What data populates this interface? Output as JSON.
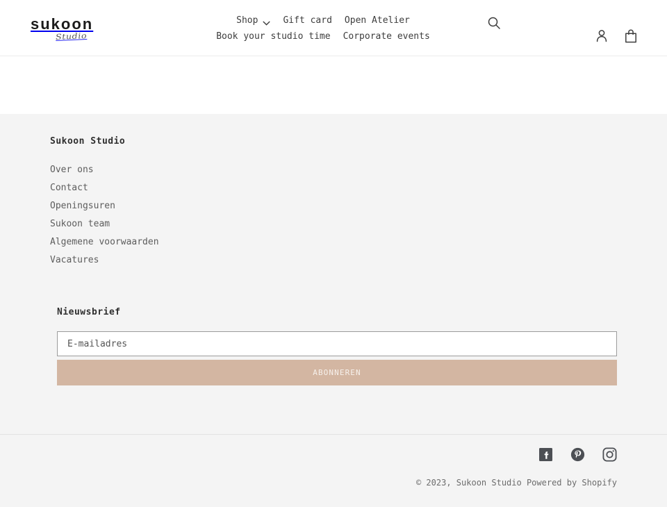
{
  "header": {
    "logo": {
      "word": "sukoon",
      "script": "Studio"
    },
    "nav": {
      "row1": [
        {
          "label": "Shop",
          "has_dropdown": true,
          "icon": "chevron-down-icon"
        },
        {
          "label": "Gift card",
          "has_dropdown": false
        },
        {
          "label": "Open Atelier",
          "has_dropdown": false
        }
      ],
      "row2": [
        {
          "label": "Book your studio time",
          "has_dropdown": false
        },
        {
          "label": "Corporate events",
          "has_dropdown": false
        }
      ]
    },
    "icons": {
      "search": "search-icon",
      "account": "account-icon",
      "cart": "cart-icon"
    }
  },
  "footer": {
    "heading": "Sukoon Studio",
    "links": [
      {
        "label": "Over ons"
      },
      {
        "label": "Contact"
      },
      {
        "label": "Openingsuren"
      },
      {
        "label": "Sukoon team"
      },
      {
        "label": "Algemene voorwaarden"
      },
      {
        "label": "Vacatures"
      }
    ],
    "newsletter": {
      "heading": "Nieuwsbrief",
      "email_placeholder": "E-mailadres",
      "email_value": "",
      "submit_label": "ABONNEREN",
      "button_color": "#d3b6a2"
    },
    "social": [
      {
        "name": "facebook-icon",
        "label": "Facebook"
      },
      {
        "name": "pinterest-icon",
        "label": "Pinterest"
      },
      {
        "name": "instagram-icon",
        "label": "Instagram"
      }
    ],
    "copyright": {
      "text": "© 2023,",
      "shop_name": "Sukoon Studio",
      "powered_by": "Powered by Shopify"
    }
  }
}
